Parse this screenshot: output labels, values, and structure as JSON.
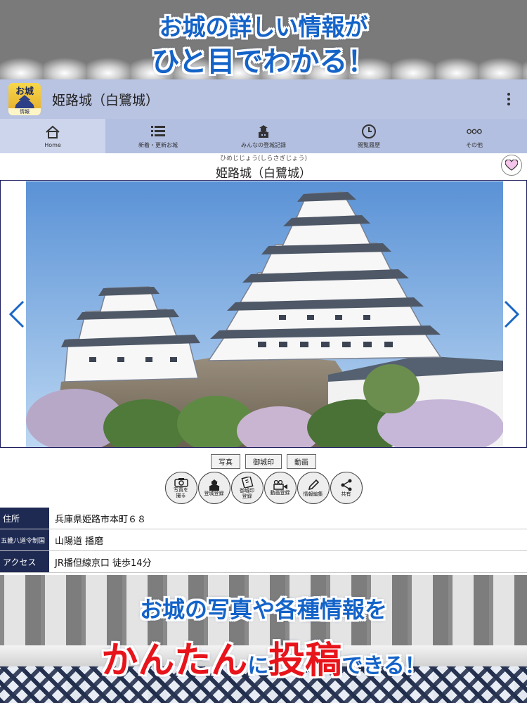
{
  "promo": {
    "top_line1": "お城の詳しい情報が",
    "top_line2": "ひと目でわかる！",
    "bottom_line1": "お城の写真や各種情報を",
    "bottom_line2_a": "かんたん",
    "bottom_line2_b": "に",
    "bottom_line2_c": "投稿",
    "bottom_line2_d": "できる！",
    "accent_blue": "#1463c8",
    "accent_red": "#e8141b"
  },
  "app": {
    "logo_text": "お城",
    "logo_sub": "情報",
    "title": "姫路城（白鷺城）",
    "bar_color": "#b9c3e2"
  },
  "nav": {
    "items": [
      {
        "label": "Home",
        "icon": "home-icon"
      },
      {
        "label": "新着・更新お城",
        "icon": "list-icon"
      },
      {
        "label": "みんなの登城記録",
        "icon": "castle-icon"
      },
      {
        "label": "閲覧履歴",
        "icon": "clock-icon"
      },
      {
        "label": "その他",
        "icon": "more-icon"
      }
    ]
  },
  "castle": {
    "ruby": "ひめじじょう(しらさぎじょう)",
    "name": "姫路城（白鷺城）"
  },
  "media_tabs": [
    "写真",
    "御城印",
    "動画"
  ],
  "actions": [
    {
      "label": "写真を\n撮る",
      "icon": "camera-icon"
    },
    {
      "label": "登城登録",
      "icon": "castle-icon"
    },
    {
      "label": "御城印\n登録",
      "icon": "stamp-icon"
    },
    {
      "label": "動画登録",
      "icon": "video-icon"
    },
    {
      "label": "情報編集",
      "icon": "pencil-icon"
    },
    {
      "label": "共有",
      "icon": "share-icon"
    }
  ],
  "info": {
    "rows": [
      {
        "key": "住所",
        "value": "兵庫県姫路市本町６８"
      },
      {
        "key": "五畿八道令制国",
        "value": "山陽道 播磨"
      },
      {
        "key": "アクセス",
        "value": "JR播但線京口 徒歩14分"
      }
    ]
  }
}
